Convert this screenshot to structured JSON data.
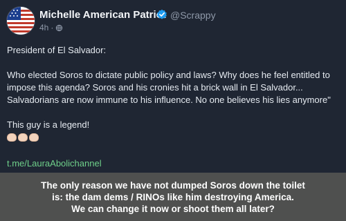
{
  "post": {
    "author_name": "Michelle American Patriot",
    "handle": "@Scrappy",
    "time": "4h",
    "separator": "·",
    "paragraphs": {
      "intro": "President of El Salvador:",
      "quote": "Who elected Soros to dictate public policy and laws? Why does he feel entitled to impose this agenda? Soros and his cronies hit a brick wall in El Salvador... Salvadorians are now immune to his influence. No one believes his lies anymore\"",
      "comment": "This guy is a legend!"
    },
    "emoji_reaction": "clapping-hands",
    "link_text": "t.me/LauraAbolichannel",
    "icons": {
      "verified": "verified-badge-icon",
      "visibility": "globe-icon"
    },
    "colors": {
      "background": "#1f2633",
      "link": "#6fd08a",
      "verified": "#1d9bf0"
    }
  },
  "caption": {
    "line1": "The only reason we have not dumped Soros down the toilet",
    "line2": "is: the dam dems / RINOs like him destroying America.",
    "line3": "We can change it now or shoot them all later?",
    "background": "#4f504f"
  }
}
